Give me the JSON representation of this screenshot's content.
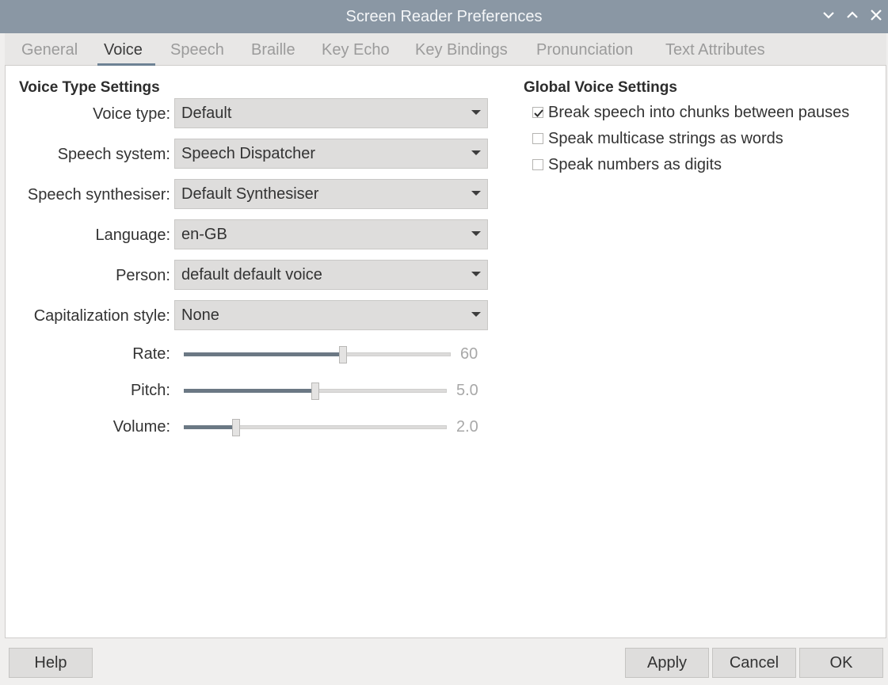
{
  "window": {
    "title": "Screen Reader Preferences"
  },
  "tabs": [
    {
      "label": "General",
      "active": false
    },
    {
      "label": "Voice",
      "active": true
    },
    {
      "label": "Speech",
      "active": false
    },
    {
      "label": "Braille",
      "active": false
    },
    {
      "label": "Key Echo",
      "active": false
    },
    {
      "label": "Key Bindings",
      "active": false
    },
    {
      "label": "Pronunciation",
      "active": false
    },
    {
      "label": "Text Attributes",
      "active": false
    }
  ],
  "voice_type_settings": {
    "title": "Voice Type Settings",
    "fields": [
      {
        "label": "Voice type:",
        "value": "Default"
      },
      {
        "label": "Speech system:",
        "value": "Speech Dispatcher"
      },
      {
        "label": "Speech synthesiser:",
        "value": "Default Synthesiser"
      },
      {
        "label": "Language:",
        "value": "en-GB"
      },
      {
        "label": "Person:",
        "value": "default default voice"
      },
      {
        "label": "Capitalization style:",
        "value": "None"
      }
    ],
    "sliders": [
      {
        "label": "Rate:",
        "value": "60",
        "fraction": 0.597
      },
      {
        "label": "Pitch:",
        "value": "5.0",
        "fraction": 0.5
      },
      {
        "label": "Volume:",
        "value": "2.0",
        "fraction": 0.2
      }
    ]
  },
  "global_voice_settings": {
    "title": "Global Voice Settings",
    "options": [
      {
        "label": "Break speech into chunks between pauses",
        "checked": true
      },
      {
        "label": "Speak multicase strings as words",
        "checked": false
      },
      {
        "label": "Speak numbers as digits",
        "checked": false
      }
    ]
  },
  "buttons": {
    "help": "Help",
    "apply": "Apply",
    "cancel": "Cancel",
    "ok": "OK"
  },
  "colors": {
    "titlebar": "#8a97a4",
    "accent": "#6e8294",
    "slider_fill": "#6b7884"
  },
  "icons": {
    "minimize": "chevron-down-icon",
    "maximize": "chevron-up-icon",
    "close": "close-icon",
    "check": "checkmark-icon"
  }
}
